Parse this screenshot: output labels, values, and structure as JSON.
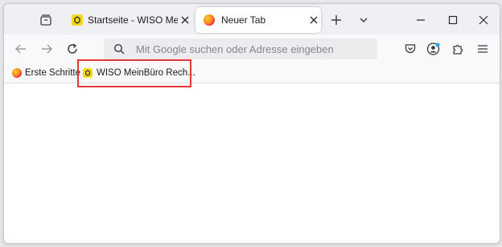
{
  "tabs": [
    {
      "label": "Startseite - WISO MeinBüro Rechnung",
      "icon": "wiso-icon",
      "active": false
    },
    {
      "label": "Neuer Tab",
      "icon": "firefox-icon",
      "active": true
    }
  ],
  "toolbar": {
    "url_placeholder": "Mit Google suchen oder Adresse eingeben"
  },
  "bookmarks": [
    {
      "label": "Erste Schritte",
      "icon": "firefox-icon"
    },
    {
      "label": "WISO MeinBüro Rech...",
      "icon": "wiso-icon"
    }
  ],
  "icons": {
    "tab_overview": "firefox-view-icon",
    "new_tab": "plus-icon",
    "list_tabs": "chevron-down-icon",
    "minimize": "minimize-icon",
    "maximize": "maximize-icon",
    "close": "close-icon",
    "back": "back-arrow-icon",
    "forward": "forward-arrow-icon",
    "reload": "reload-icon",
    "search": "search-icon",
    "pocket": "pocket-icon",
    "account": "account-icon",
    "extensions": "puzzle-icon",
    "menu": "hamburger-menu-icon"
  },
  "colors": {
    "highlight": "#e53935",
    "wiso_badge": "#f4d81c",
    "account_dot": "#2aa3ef"
  }
}
